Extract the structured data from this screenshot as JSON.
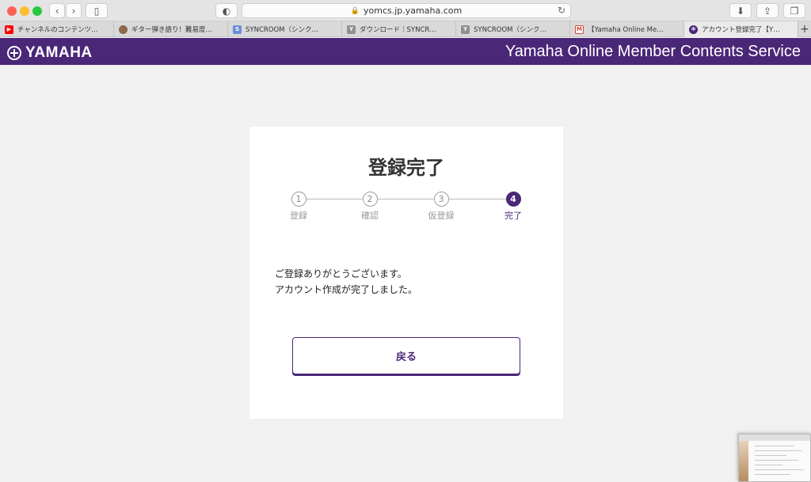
{
  "browser": {
    "url": "yomcs.jp.yamaha.com",
    "tabs": [
      {
        "label": "チャンネルのコンテンツ…",
        "icon": "youtube-icon",
        "color": "#ff0000"
      },
      {
        "label": "ギター弾き語り！難易度…",
        "icon": "avatar-icon",
        "color": "#8a6a50"
      },
      {
        "label": "SYNCROOM（シンク…",
        "icon": "syncroom-icon",
        "color": "#6b8fd6"
      },
      {
        "label": "ダウンロード｜SYNCR…",
        "icon": "y-icon",
        "color": "#8e8e93"
      },
      {
        "label": "SYNCROOM（シンク…",
        "icon": "y-icon",
        "color": "#8e8e93"
      },
      {
        "label": "【Yamaha Online Me…",
        "icon": "gmail-icon",
        "color": "#d44638"
      },
      {
        "label": "アカウント登録完了【Y…",
        "icon": "yamaha-icon",
        "color": "#4a2777"
      }
    ],
    "new_tab": "+"
  },
  "header": {
    "logo_text": "YAMAHA",
    "service_title": "Yamaha Online Member Contents Service",
    "brand_color": "#4a2777"
  },
  "card": {
    "title": "登録完了",
    "steps": [
      {
        "number": "1",
        "label": "登録",
        "active": false
      },
      {
        "number": "2",
        "label": "確認",
        "active": false
      },
      {
        "number": "3",
        "label": "仮登録",
        "active": false
      },
      {
        "number": "4",
        "label": "完了",
        "active": true
      }
    ],
    "message_line1": "ご登録ありがとうございます。",
    "message_line2": "アカウント作成が完了しました。",
    "back_button": "戻る"
  }
}
